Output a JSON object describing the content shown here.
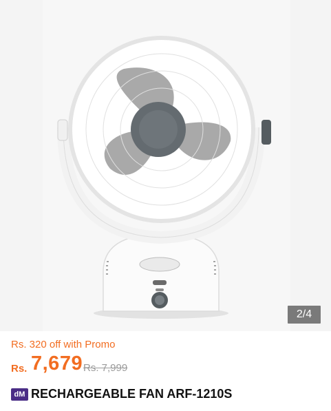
{
  "gallery": {
    "image_alt": "",
    "counter": "2/4",
    "colors": {
      "blade": "#a9a9a9",
      "hub": "#646b70",
      "body": "#ffffff"
    }
  },
  "promo": {
    "text": "Rs. 320 off with Promo"
  },
  "price": {
    "currency": "Rs.",
    "current": "7,679",
    "original": "Rs. 7,999",
    "accent_color": "#f26d21"
  },
  "product": {
    "brand_badge": "dM",
    "title": "RECHARGEABLE FAN ARF-1210S"
  }
}
